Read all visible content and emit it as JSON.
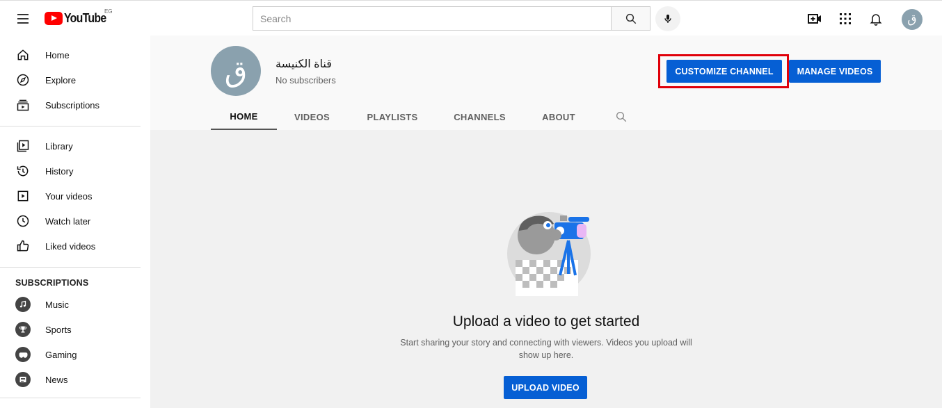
{
  "topbar": {
    "logo_text": "YouTube",
    "region": "EG",
    "search_placeholder": "Search",
    "avatar_letter": "ق"
  },
  "sidebar": {
    "primary": [
      {
        "label": "Home",
        "icon": "home-icon"
      },
      {
        "label": "Explore",
        "icon": "compass-icon"
      },
      {
        "label": "Subscriptions",
        "icon": "subscriptions-icon"
      }
    ],
    "library": [
      {
        "label": "Library",
        "icon": "library-icon"
      },
      {
        "label": "History",
        "icon": "history-icon"
      },
      {
        "label": "Your videos",
        "icon": "your-videos-icon"
      },
      {
        "label": "Watch later",
        "icon": "clock-icon"
      },
      {
        "label": "Liked videos",
        "icon": "thumbs-up-icon"
      }
    ],
    "subscriptions_heading": "SUBSCRIPTIONS",
    "subscriptions": [
      {
        "label": "Music",
        "icon": "music-icon"
      },
      {
        "label": "Sports",
        "icon": "trophy-icon"
      },
      {
        "label": "Gaming",
        "icon": "gamepad-icon"
      },
      {
        "label": "News",
        "icon": "news-icon"
      }
    ]
  },
  "channel": {
    "avatar_letter": "ق",
    "name": "قناة الكنيسة",
    "subscribers": "No subscribers",
    "customize_label": "CUSTOMIZE CHANNEL",
    "manage_label": "MANAGE VIDEOS",
    "tabs": [
      "HOME",
      "VIDEOS",
      "PLAYLISTS",
      "CHANNELS",
      "ABOUT"
    ],
    "active_tab": "HOME"
  },
  "empty_state": {
    "title": "Upload a video to get started",
    "subtitle": "Start sharing your story and connecting with viewers. Videos you upload will show up here.",
    "button_label": "UPLOAD VIDEO"
  },
  "colors": {
    "accent": "#065fd4",
    "highlight": "#e0000a",
    "brand_red": "#ff0000"
  }
}
